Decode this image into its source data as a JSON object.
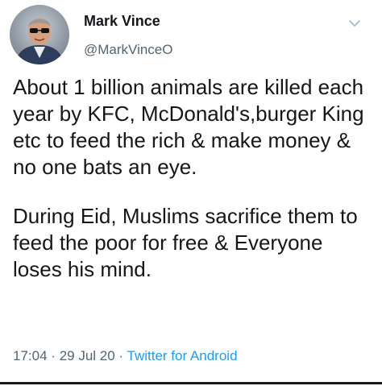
{
  "author": {
    "name": "Mark Vince",
    "handle": "@MarkVinceO",
    "avatar_icon": "profile-photo"
  },
  "tweet": {
    "paragraphs": [
      "About 1 billion animals are killed each year by KFC, McDonald's,burger King etc to feed the rich & make money & no one bats an eye.",
      "During Eid, Muslims sacrifice them to feed the poor for free & Everyone loses his mind."
    ],
    "time": "17:04",
    "separator": "·",
    "date": "29 Jul 20",
    "source": "Twitter for Android"
  },
  "menu": {
    "icon": "chevron-down-icon"
  },
  "colors": {
    "text": "#14171a",
    "secondary": "#536471",
    "link": "#1d9bf0"
  }
}
